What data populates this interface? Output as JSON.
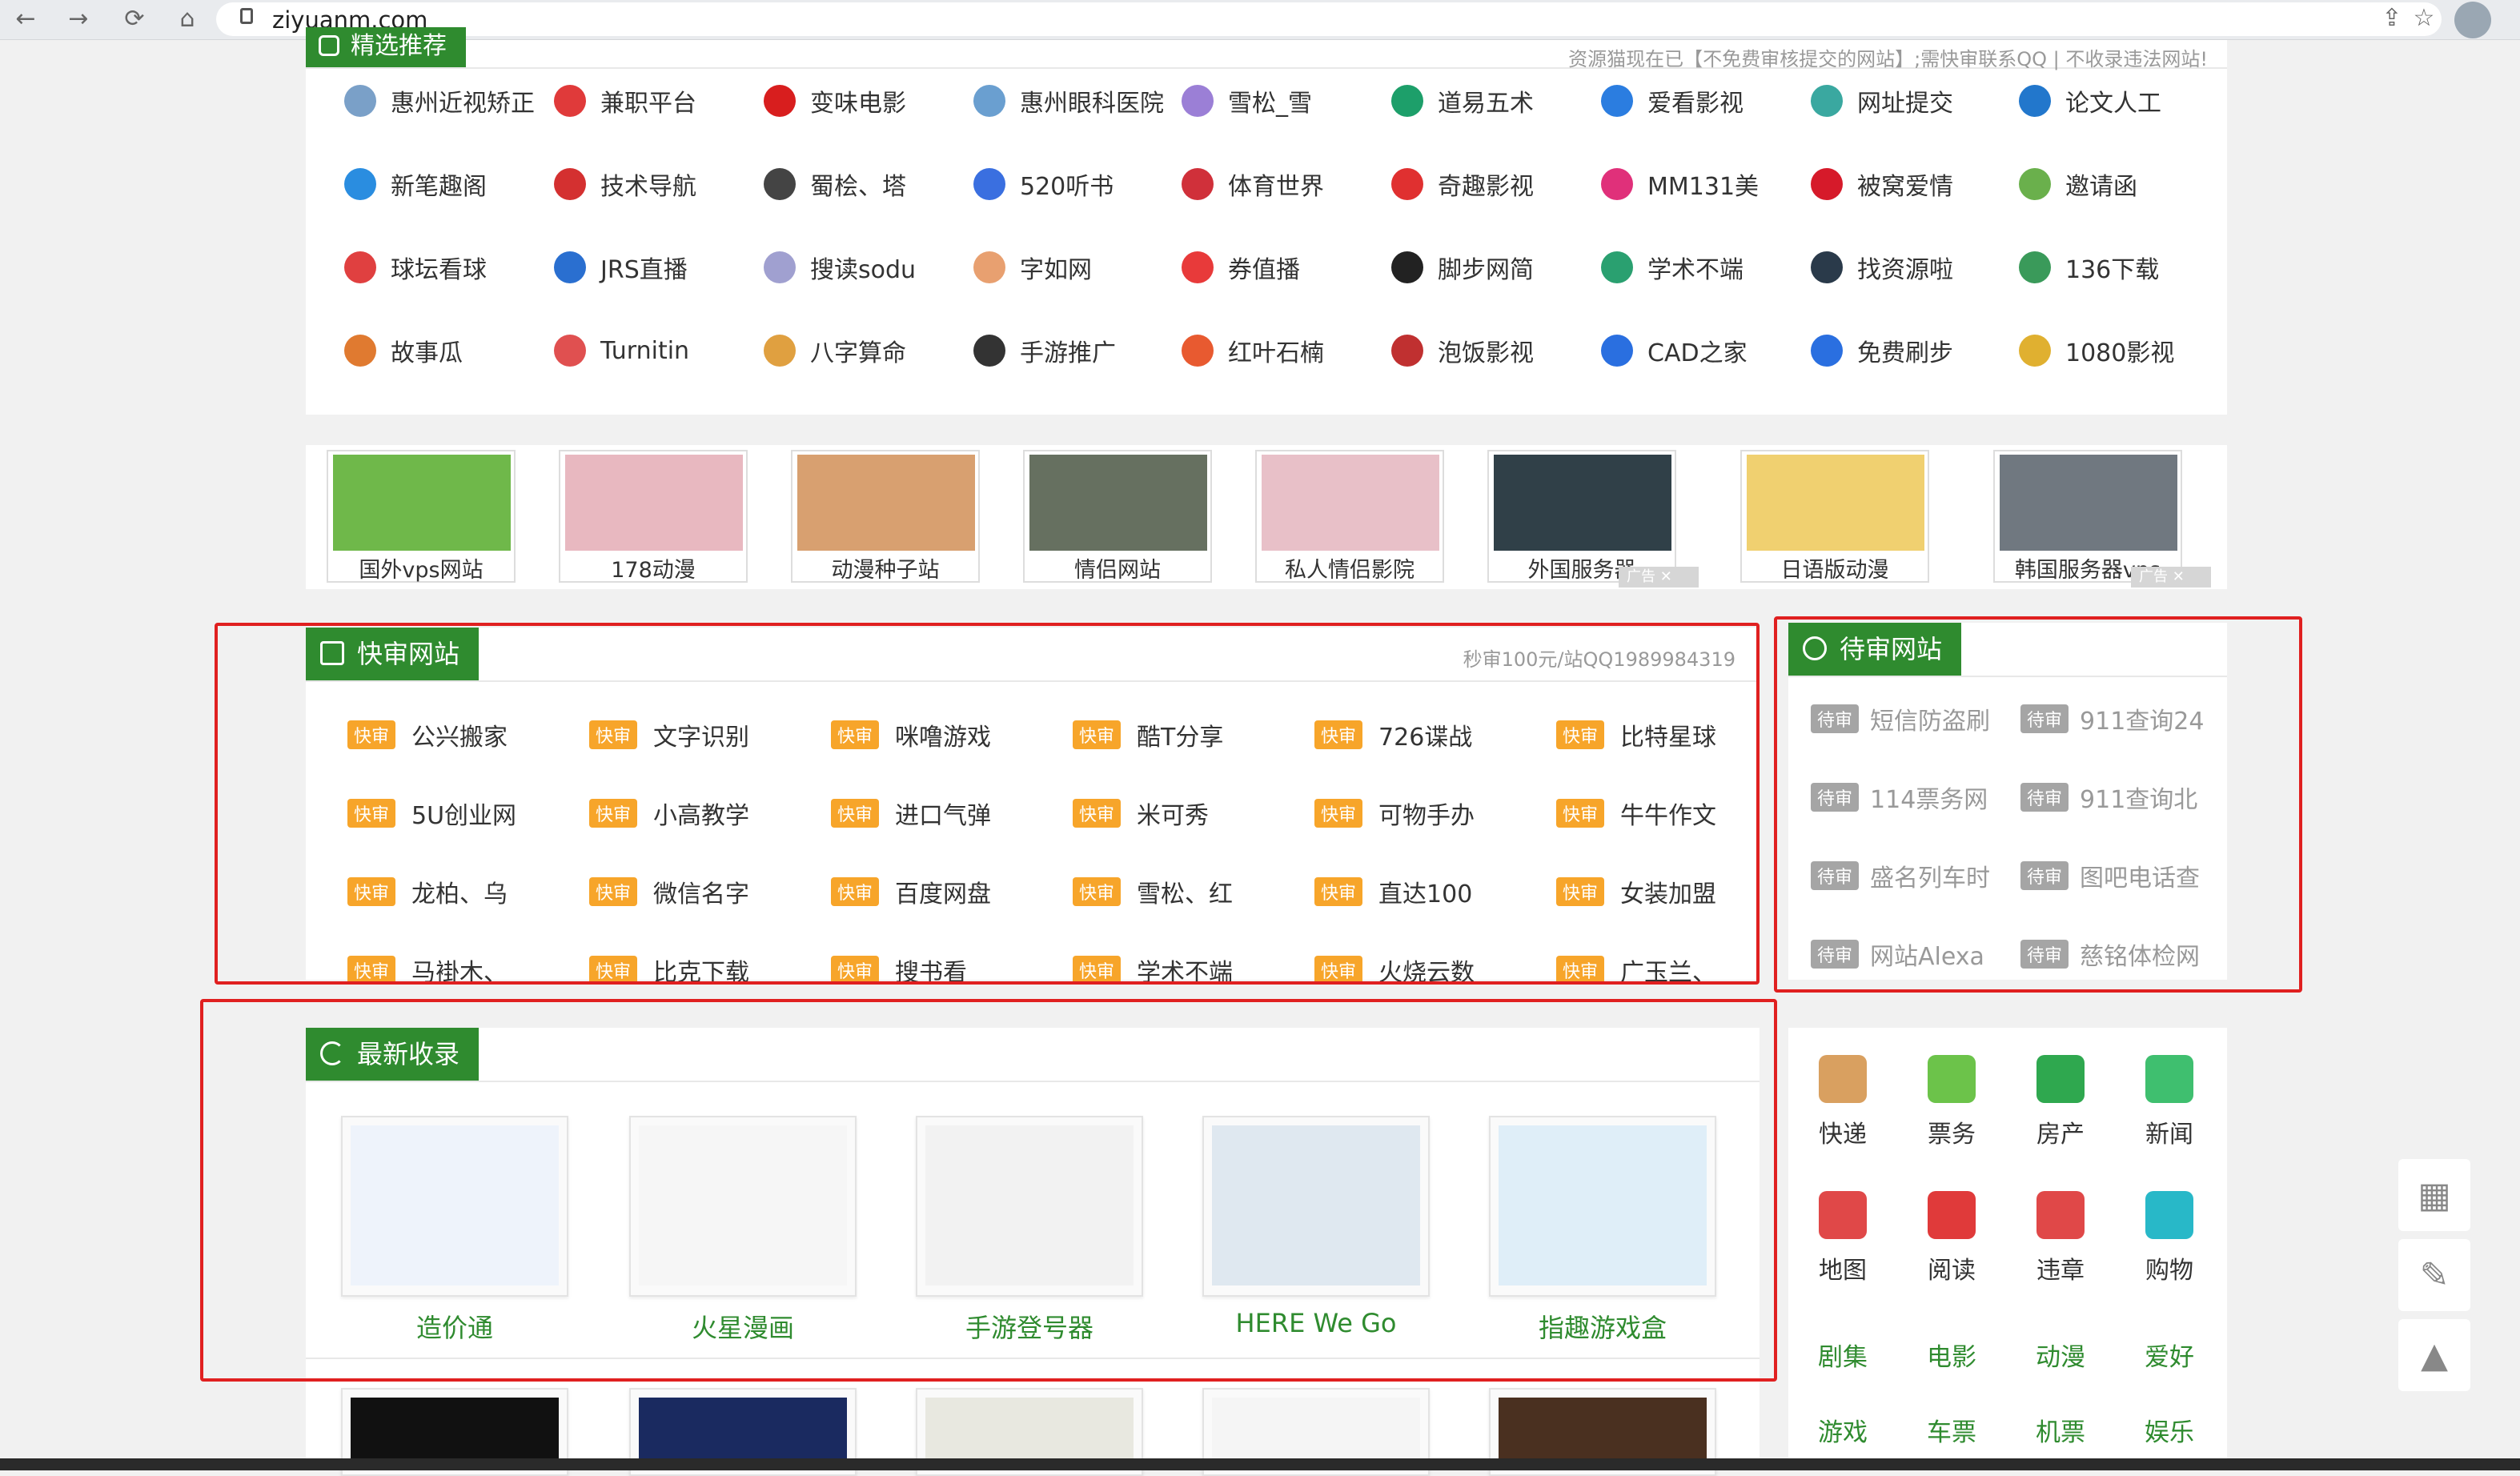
{
  "browser": {
    "url": "ziyuanm.com",
    "back": "←",
    "forward": "→",
    "reload": "⟳",
    "home": "⌂",
    "share": "⇪",
    "star": "☆"
  },
  "featured": {
    "title": "精选推荐",
    "notice": "资源猫现在已【不免费审核提交的网站】;需快审联系QQ | 不收录违法网站!",
    "sites": [
      [
        "惠州近视矫正",
        "兼职平台",
        "变味电影",
        "惠州眼科医院",
        "雪松_雪",
        "道易五术",
        "爱看影视",
        "网址提交",
        "论文人工"
      ],
      [
        "新笔趣阁",
        "技术导航",
        "蜀桧、塔",
        "520听书",
        "体育世界",
        "奇趣影视",
        "MM131美",
        "被窝爱情",
        "邀请函"
      ],
      [
        "球坛看球",
        "JRS直播",
        "搜读sodu",
        "字如网",
        "券值播",
        "脚步网简",
        "学术不端",
        "找资源啦",
        "136下载"
      ],
      [
        "故事瓜",
        "Turnitin",
        "八字算命",
        "手游推广",
        "红叶石楠",
        "泡饭影视",
        "CAD之家",
        "免费刷步",
        "1080影视"
      ]
    ],
    "icon_colors": [
      [
        "#7aa0c8",
        "#e03a3a",
        "#d81e1e",
        "#6a9fd0",
        "#9b7fd6",
        "#1d9f6a",
        "#2b7de0",
        "#3aa8a0",
        "#2277cc"
      ],
      [
        "#2a8de0",
        "#d43030",
        "#444444",
        "#3a6fe0",
        "#d0303a",
        "#e03030",
        "#e0307a",
        "#d61a2a",
        "#6ab04c"
      ],
      [
        "#e04040",
        "#2a6fd0",
        "#a0a0d0",
        "#e8a070",
        "#e83a3a",
        "#222222",
        "#2aa070",
        "#2a3a4a",
        "#3a9a5a"
      ],
      [
        "#e07a30",
        "#e05050",
        "#e0a040",
        "#333333",
        "#e85a30",
        "#c03030",
        "#2a6fe0",
        "#2a6fe0",
        "#e0b030"
      ]
    ]
  },
  "ads": {
    "items": [
      "国外vps网站",
      "178动漫",
      "动漫种子站",
      "情侣网站",
      "私人情侣影院",
      "外国服务器",
      "日语版动漫",
      "韩国服务器vps"
    ],
    "label": "广告",
    "close": "✕"
  },
  "fast_review": {
    "title": "快审网站",
    "notice": "秒审100元/站QQ1989984319",
    "badge": "快审",
    "sites": [
      [
        "公兴搬家",
        "文字识别",
        "咪噜游戏",
        "酷T分享",
        "726谍战",
        "比特星球"
      ],
      [
        "5U创业网",
        "小高教学",
        "进口气弹",
        "米可秀",
        "可物手办",
        "牛牛作文"
      ],
      [
        "龙柏、乌",
        "微信名字",
        "百度网盘",
        "雪松、红",
        "直达100",
        "女装加盟"
      ],
      [
        "马褂木、",
        "比克下载",
        "搜书看",
        "学术不端",
        "火烧云数",
        "广玉兰、"
      ]
    ]
  },
  "pending": {
    "title": "待审网站",
    "badge": "待审",
    "sites": [
      [
        "短信防盗刷",
        "911查询24"
      ],
      [
        "114票务网",
        "911查询北"
      ],
      [
        "盛名列车时",
        "图吧电话查"
      ],
      [
        "网站Alexa",
        "慈铭体检网"
      ]
    ]
  },
  "latest": {
    "title": "最新收录",
    "items": [
      "造价通",
      "火星漫画",
      "手游登号器",
      "HERE We Go",
      "指趣游戏盒"
    ]
  },
  "categories": {
    "icons": [
      {
        "label": "快递",
        "color": "#d9a060",
        "icon": "box-icon"
      },
      {
        "label": "票务",
        "color": "#6cc34a",
        "icon": "ticket-icon"
      },
      {
        "label": "房产",
        "color": "#2fa84f",
        "icon": "house-icon"
      },
      {
        "label": "新闻",
        "color": "#3fbf6f",
        "icon": "news-icon"
      },
      {
        "label": "地图",
        "color": "#e04848",
        "icon": "map-icon"
      },
      {
        "label": "阅读",
        "color": "#e03a3a",
        "icon": "book-icon"
      },
      {
        "label": "违章",
        "color": "#e04848",
        "icon": "stop-sign-icon"
      },
      {
        "label": "购物",
        "color": "#28b8c8",
        "icon": "shopping-bag-icon"
      }
    ],
    "words": [
      "剧集",
      "电影",
      "动漫",
      "爱好",
      "游戏",
      "车票",
      "机票",
      "娱乐"
    ]
  },
  "side": {
    "qr": "▦",
    "edit": "✎",
    "rocket": "▲"
  }
}
